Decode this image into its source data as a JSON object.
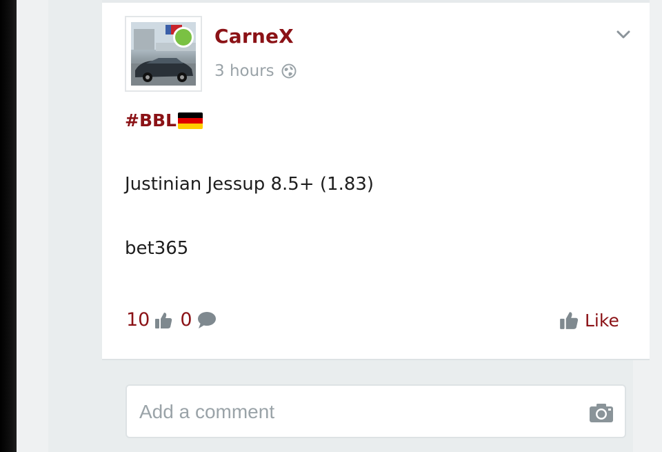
{
  "post": {
    "author": "CarneX",
    "time": "3 hours",
    "visibility_icon": "globe-icon",
    "menu_icon": "chevron-down-icon",
    "hashtag": "#BBL",
    "flag": "germany-flag",
    "lines": [
      "Justinian Jessup 8.5+ (1.83)",
      "bet365"
    ],
    "likes_count": "10",
    "comments_count": "0",
    "like_label": "Like",
    "online": true
  },
  "comment": {
    "placeholder": "Add a comment",
    "camera_icon": "camera-icon"
  },
  "colors": {
    "accent": "#8b1216",
    "online": "#7ac143",
    "muted": "#9aa3a8"
  }
}
